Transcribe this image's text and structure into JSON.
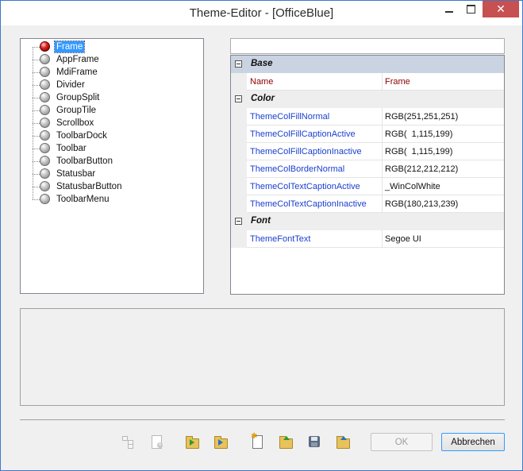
{
  "window": {
    "title": "Theme-Editor - [OfficeBlue]",
    "close_glyph": "✕"
  },
  "tree": {
    "items": [
      {
        "label": "Frame",
        "selected": true
      },
      {
        "label": "AppFrame"
      },
      {
        "label": "MdiFrame"
      },
      {
        "label": "Divider"
      },
      {
        "label": "GroupSplit"
      },
      {
        "label": "GroupTile"
      },
      {
        "label": "Scrollbox"
      },
      {
        "label": "ToolbarDock"
      },
      {
        "label": "Toolbar"
      },
      {
        "label": "ToolbarButton"
      },
      {
        "label": "Statusbar"
      },
      {
        "label": "StatusbarButton"
      },
      {
        "label": "ToolbarMenu"
      }
    ]
  },
  "search": {
    "value": ""
  },
  "properties": {
    "base": {
      "label": "Base",
      "header_name": "Name",
      "header_value": "Frame"
    },
    "color": {
      "label": "Color",
      "rows": [
        {
          "name": "ThemeColFillNormal",
          "value": "RGB(251,251,251)"
        },
        {
          "name": "ThemeColFillCaptionActive",
          "value": "RGB(  1,115,199)"
        },
        {
          "name": "ThemeColFillCaptionInactive",
          "value": "RGB(  1,115,199)"
        },
        {
          "name": "ThemeColBorderNormal",
          "value": "RGB(212,212,212)"
        },
        {
          "name": "ThemeColTextCaptionActive",
          "value": "_WinColWhite"
        },
        {
          "name": "ThemeColTextCaptionInactive",
          "value": "RGB(180,213,239)"
        }
      ]
    },
    "font": {
      "label": "Font",
      "rows": [
        {
          "name": "ThemeFontText",
          "value": "Segoe UI"
        }
      ]
    }
  },
  "buttons": {
    "ok": "OK",
    "cancel": "Abbrechen"
  },
  "toolbar_icons": [
    "tree-structure-icon",
    "delete-document-icon",
    "import-folder-icon",
    "export-folder-icon",
    "new-document-icon",
    "open-folder-icon",
    "save-disk-icon",
    "save-as-folder-icon"
  ],
  "colors": {
    "window_border": "#3c78c8",
    "close_button": "#c75050",
    "selection": "#3399ff",
    "property_name": "#1a3fcf",
    "header_text": "#8b0000",
    "category_base": "#c9d3e2"
  }
}
